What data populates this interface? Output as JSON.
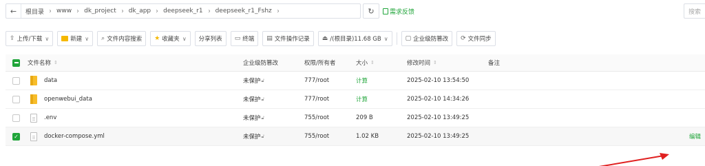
{
  "address_bar": {
    "back_icon": "←",
    "crumbs": [
      "根目录",
      "www",
      "dk_project",
      "dk_app",
      "deepseek_r1",
      "deepseek_r1_Fshz"
    ],
    "sep": "›",
    "refresh_icon": "↻",
    "feedback_label": "需求反馈",
    "search_placeholder": "搜索"
  },
  "toolbar": {
    "upload_label": "上传/下载",
    "new_label": "新建",
    "content_search_label": "文件内容搜索",
    "favorites_label": "收藏夹",
    "share_list_label": "分享列表",
    "terminal_label": "终端",
    "op_log_label": "文件操作记录",
    "disk_label": "/(根目录)11.68 GB",
    "tamper_label": "企业级防篡改",
    "sync_label": "文件同步",
    "dropdown_icon": "∨"
  },
  "table": {
    "headers": {
      "name": "文件名称",
      "tamper": "企业级防篡改",
      "perm": "权限/所有者",
      "size": "大小",
      "mtime": "修改时间",
      "note": "备注"
    },
    "rows": [
      {
        "type": "folder",
        "name": "data",
        "tamper": "未保护",
        "perm": "777/root",
        "size": "计算",
        "mtime": "2025-02-10 13:54:50",
        "checked": false
      },
      {
        "type": "folder",
        "name": "openwebui_data",
        "tamper": "未保护",
        "perm": "777/root",
        "size": "计算",
        "mtime": "2025-02-10 14:34:26",
        "checked": false
      },
      {
        "type": "file",
        "name": ".env",
        "tamper": "未保护",
        "perm": "755/root",
        "size": "209 B",
        "mtime": "2025-02-10 13:49:25",
        "checked": false
      },
      {
        "type": "file",
        "name": "docker-compose.yml",
        "tamper": "未保护",
        "perm": "755/root",
        "size": "1.02 KB",
        "mtime": "2025-02-10 13:49:25",
        "checked": true,
        "action": "编辑"
      }
    ]
  },
  "colors": {
    "accent": "#20a53a",
    "arrow": "#e02020",
    "folder": "#f7bd2a"
  }
}
